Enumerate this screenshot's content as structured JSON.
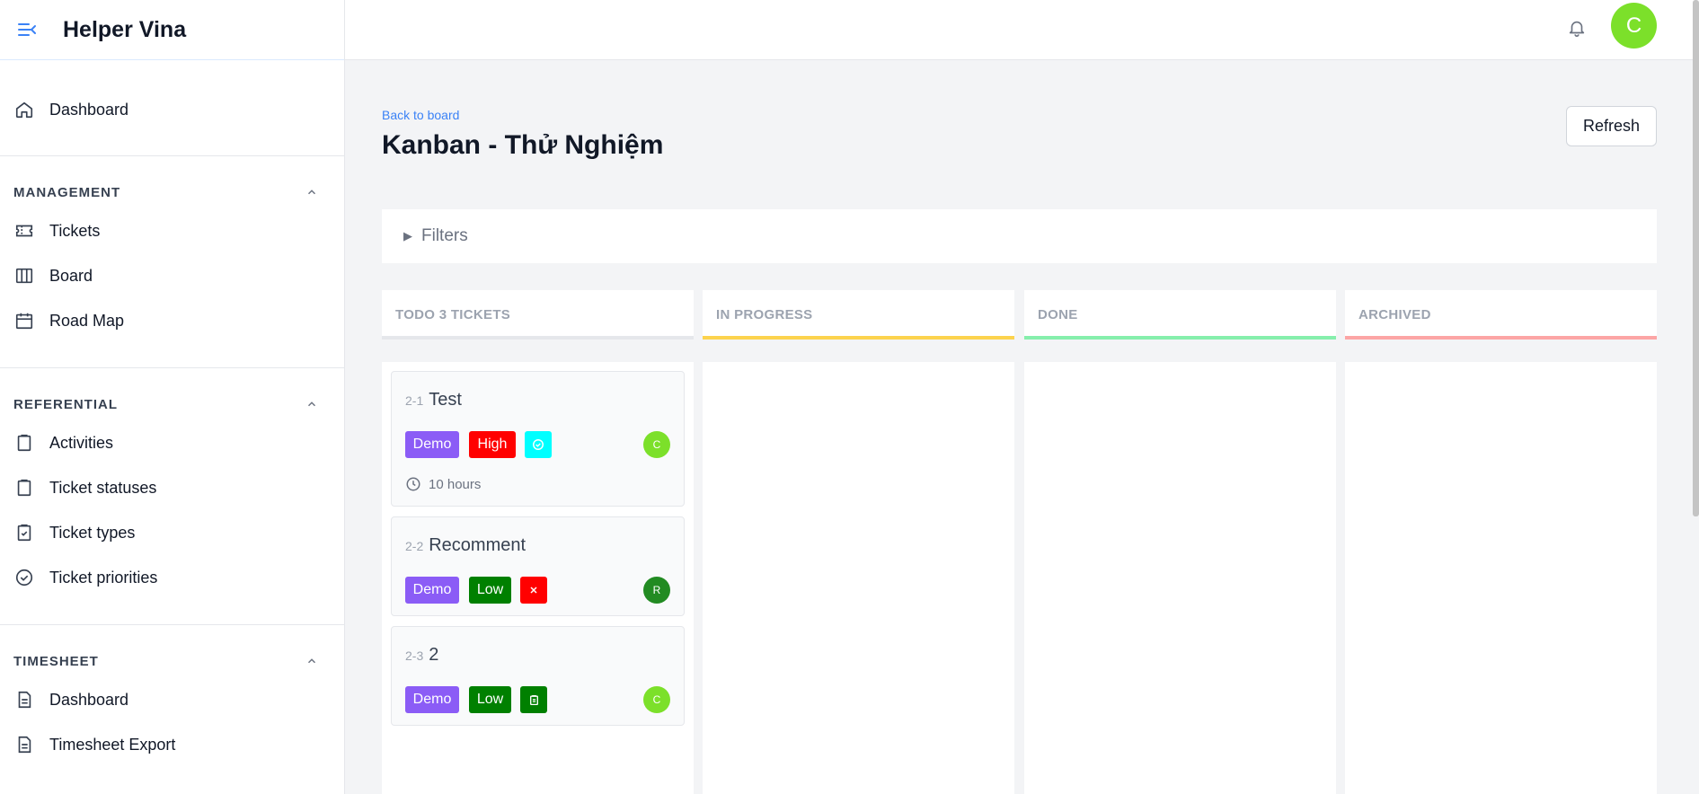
{
  "app": {
    "title": "Helper Vina"
  },
  "sidebar": {
    "dashboard": "Dashboard",
    "groups": [
      {
        "title": "MANAGEMENT",
        "items": [
          "Tickets",
          "Board",
          "Road Map"
        ]
      },
      {
        "title": "REFERENTIAL",
        "items": [
          "Activities",
          "Ticket statuses",
          "Ticket types",
          "Ticket priorities"
        ]
      },
      {
        "title": "TIMESHEET",
        "items": [
          "Dashboard",
          "Timesheet Export"
        ]
      }
    ]
  },
  "topbar": {
    "user_initial": "C"
  },
  "page": {
    "back_link": "Back to board",
    "title": "Kanban - Thử Nghiệm",
    "refresh": "Refresh",
    "filters": "Filters"
  },
  "columns": [
    {
      "title": "TODO 3 TICKETS",
      "color": "#e5e7eb"
    },
    {
      "title": "IN PROGRESS",
      "color": "#fcd34d"
    },
    {
      "title": "DONE",
      "color": "#86efac"
    },
    {
      "title": "ARCHIVED",
      "color": "#fca5a5"
    }
  ],
  "cards": [
    {
      "code": "2-1",
      "title": "Test",
      "project": "Demo",
      "priority": "High",
      "type_icon": "check-circle-icon",
      "assignee": "C",
      "time": "10 hours"
    },
    {
      "code": "2-2",
      "title": "Recomment",
      "project": "Demo",
      "priority": "Low",
      "type_icon": "x-icon",
      "assignee": "R"
    },
    {
      "code": "2-3",
      "title": "2",
      "project": "Demo",
      "priority": "Low",
      "type_icon": "clipboard-icon",
      "assignee": "C"
    }
  ],
  "colors": {
    "accent": "#3b82f6",
    "demo_tag": "#8b5cf6",
    "high": "#ff0000",
    "low": "#008000",
    "cyan": "#00ffff",
    "avatar_green_light": "#7ce02a",
    "avatar_green_dark": "#228b22"
  }
}
